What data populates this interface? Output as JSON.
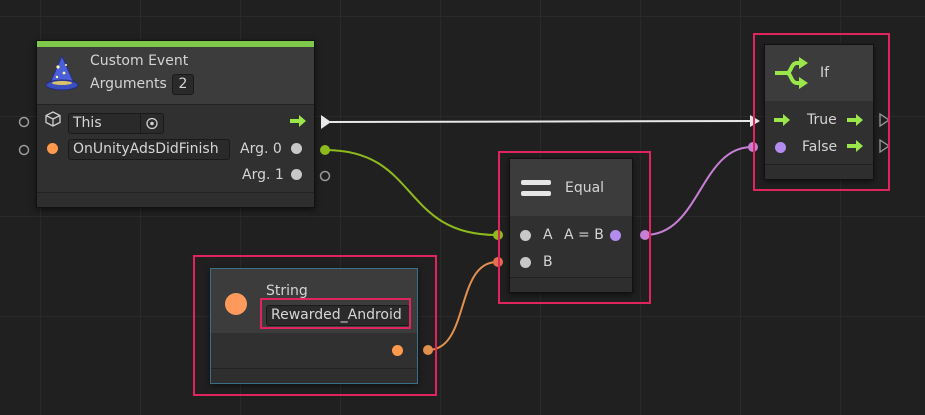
{
  "custom_event": {
    "title": "Custom Event",
    "arguments_label": "Arguments",
    "arguments_value": "2",
    "this_value": "This",
    "event_name_value": "OnUnityAdsDidFinish",
    "arg0_label": "Arg. 0",
    "arg1_label": "Arg. 1"
  },
  "string_node": {
    "title": "String",
    "value": "Rewarded_Android"
  },
  "equal_node": {
    "title": "Equal",
    "input_a_label": "A",
    "input_b_label": "B",
    "output_label": "A = B"
  },
  "if_node": {
    "title": "If",
    "true_label": "True",
    "false_label": "False"
  },
  "colors": {
    "flow": "#9be64b",
    "object": "#ff9a4d",
    "boolean": "#b48cf0",
    "highlight": "#e0245e",
    "header_accent": "#7ec84a"
  }
}
